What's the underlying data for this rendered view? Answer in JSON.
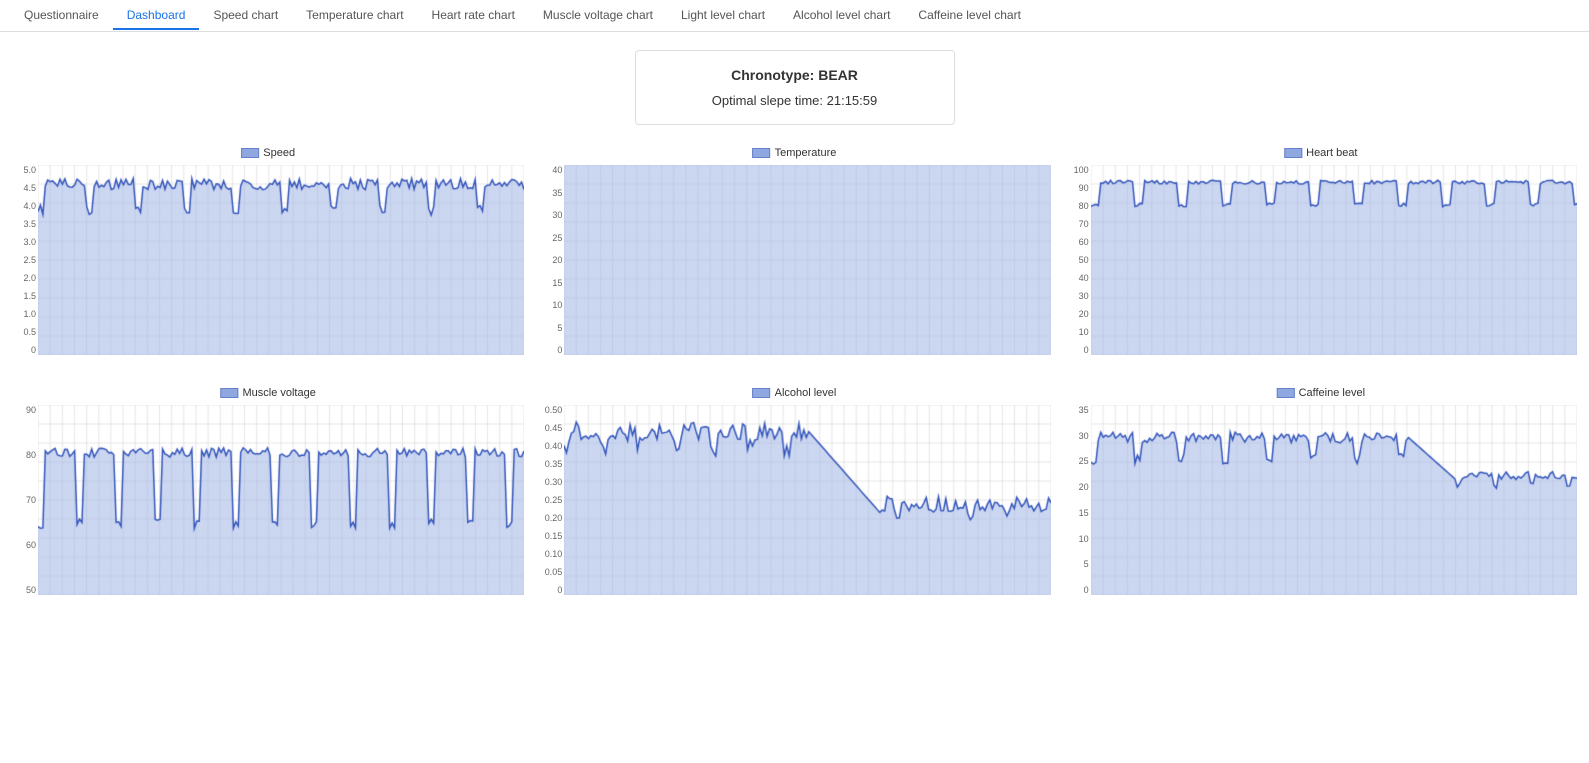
{
  "nav": {
    "items": [
      {
        "label": "Questionnaire",
        "active": false
      },
      {
        "label": "Dashboard",
        "active": true
      },
      {
        "label": "Speed chart",
        "active": false
      },
      {
        "label": "Temperature chart",
        "active": false
      },
      {
        "label": "Heart rate chart",
        "active": false
      },
      {
        "label": "Muscle voltage chart",
        "active": false
      },
      {
        "label": "Light level chart",
        "active": false
      },
      {
        "label": "Alcohol level chart",
        "active": false
      },
      {
        "label": "Caffeine level chart",
        "active": false
      }
    ]
  },
  "infoCard": {
    "chronotype": "Chronotype: BEAR",
    "sleepTime": "Optimal slepe time: 21:15:59"
  },
  "charts": {
    "row1": [
      {
        "id": "speed",
        "legend": "Speed",
        "yMax": 5.0,
        "yLabels": [
          "5.0",
          "4.5",
          "4.0",
          "3.5",
          "3.0",
          "2.5",
          "2.0",
          "1.5",
          "1.0",
          "0.5",
          "0"
        ]
      },
      {
        "id": "temperature",
        "legend": "Temperature",
        "yMax": 40,
        "yLabels": [
          "40",
          "35",
          "30",
          "25",
          "20",
          "15",
          "10",
          "5",
          "0"
        ]
      },
      {
        "id": "heartbeat",
        "legend": "Heart beat",
        "yMax": 100,
        "yLabels": [
          "100",
          "90",
          "80",
          "70",
          "60",
          "50",
          "40",
          "30",
          "20",
          "10",
          "0"
        ]
      }
    ],
    "row2": [
      {
        "id": "musclevoltage",
        "legend": "Muscle voltage",
        "yMax": 90,
        "yLabels": [
          "90",
          "80",
          "70",
          "60",
          "50"
        ]
      },
      {
        "id": "alcohollevel",
        "legend": "Alcohol level",
        "yMax": 0.5,
        "yLabels": [
          "0.50",
          "0.45",
          "0.40",
          "0.35",
          "0.30",
          "0.25",
          "0.20",
          "0.15",
          "0.10",
          "0.05",
          "0"
        ]
      },
      {
        "id": "caffeinelevel",
        "legend": "Caffeine level",
        "yMax": 35,
        "yLabels": [
          "35",
          "30",
          "25",
          "20",
          "15",
          "10",
          "5",
          "0"
        ]
      }
    ]
  }
}
